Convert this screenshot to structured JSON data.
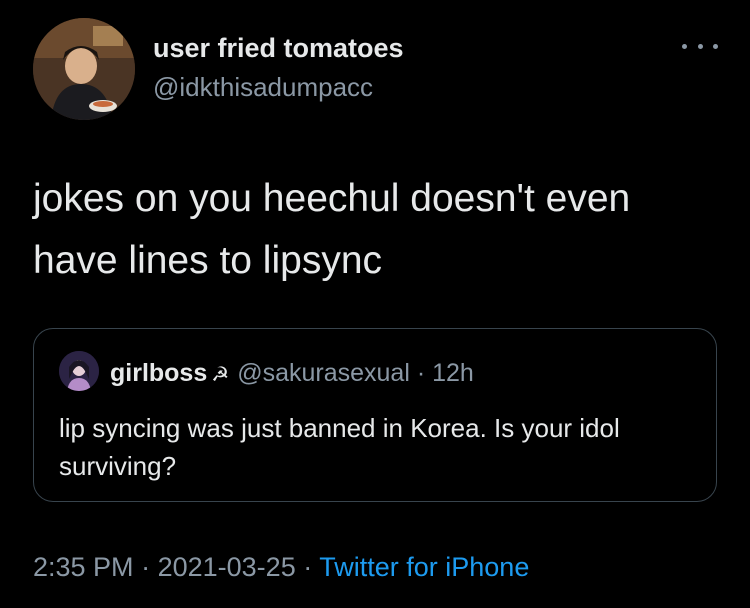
{
  "author": {
    "display_name": "user fried tomatoes",
    "handle": "@idkthisadumpacc",
    "avatar_icon": "avatar-photo"
  },
  "tweet": {
    "text": "jokes on you heechul doesn't even have lines to lipsync"
  },
  "quoted": {
    "display_name": "girlboss",
    "emoji": "☭",
    "handle": "@sakurasexual",
    "separator": "·",
    "time": "12h",
    "text": "lip syncing was just banned in Korea. Is your idol surviving?"
  },
  "footer": {
    "time": "2:35 PM",
    "separator": "·",
    "date": "2021-03-25",
    "source": "Twitter for iPhone"
  },
  "colors": {
    "background": "#000000",
    "text": "#e7e9ea",
    "muted": "#8b98a5",
    "link": "#1d9bf0",
    "border": "#38444d"
  }
}
